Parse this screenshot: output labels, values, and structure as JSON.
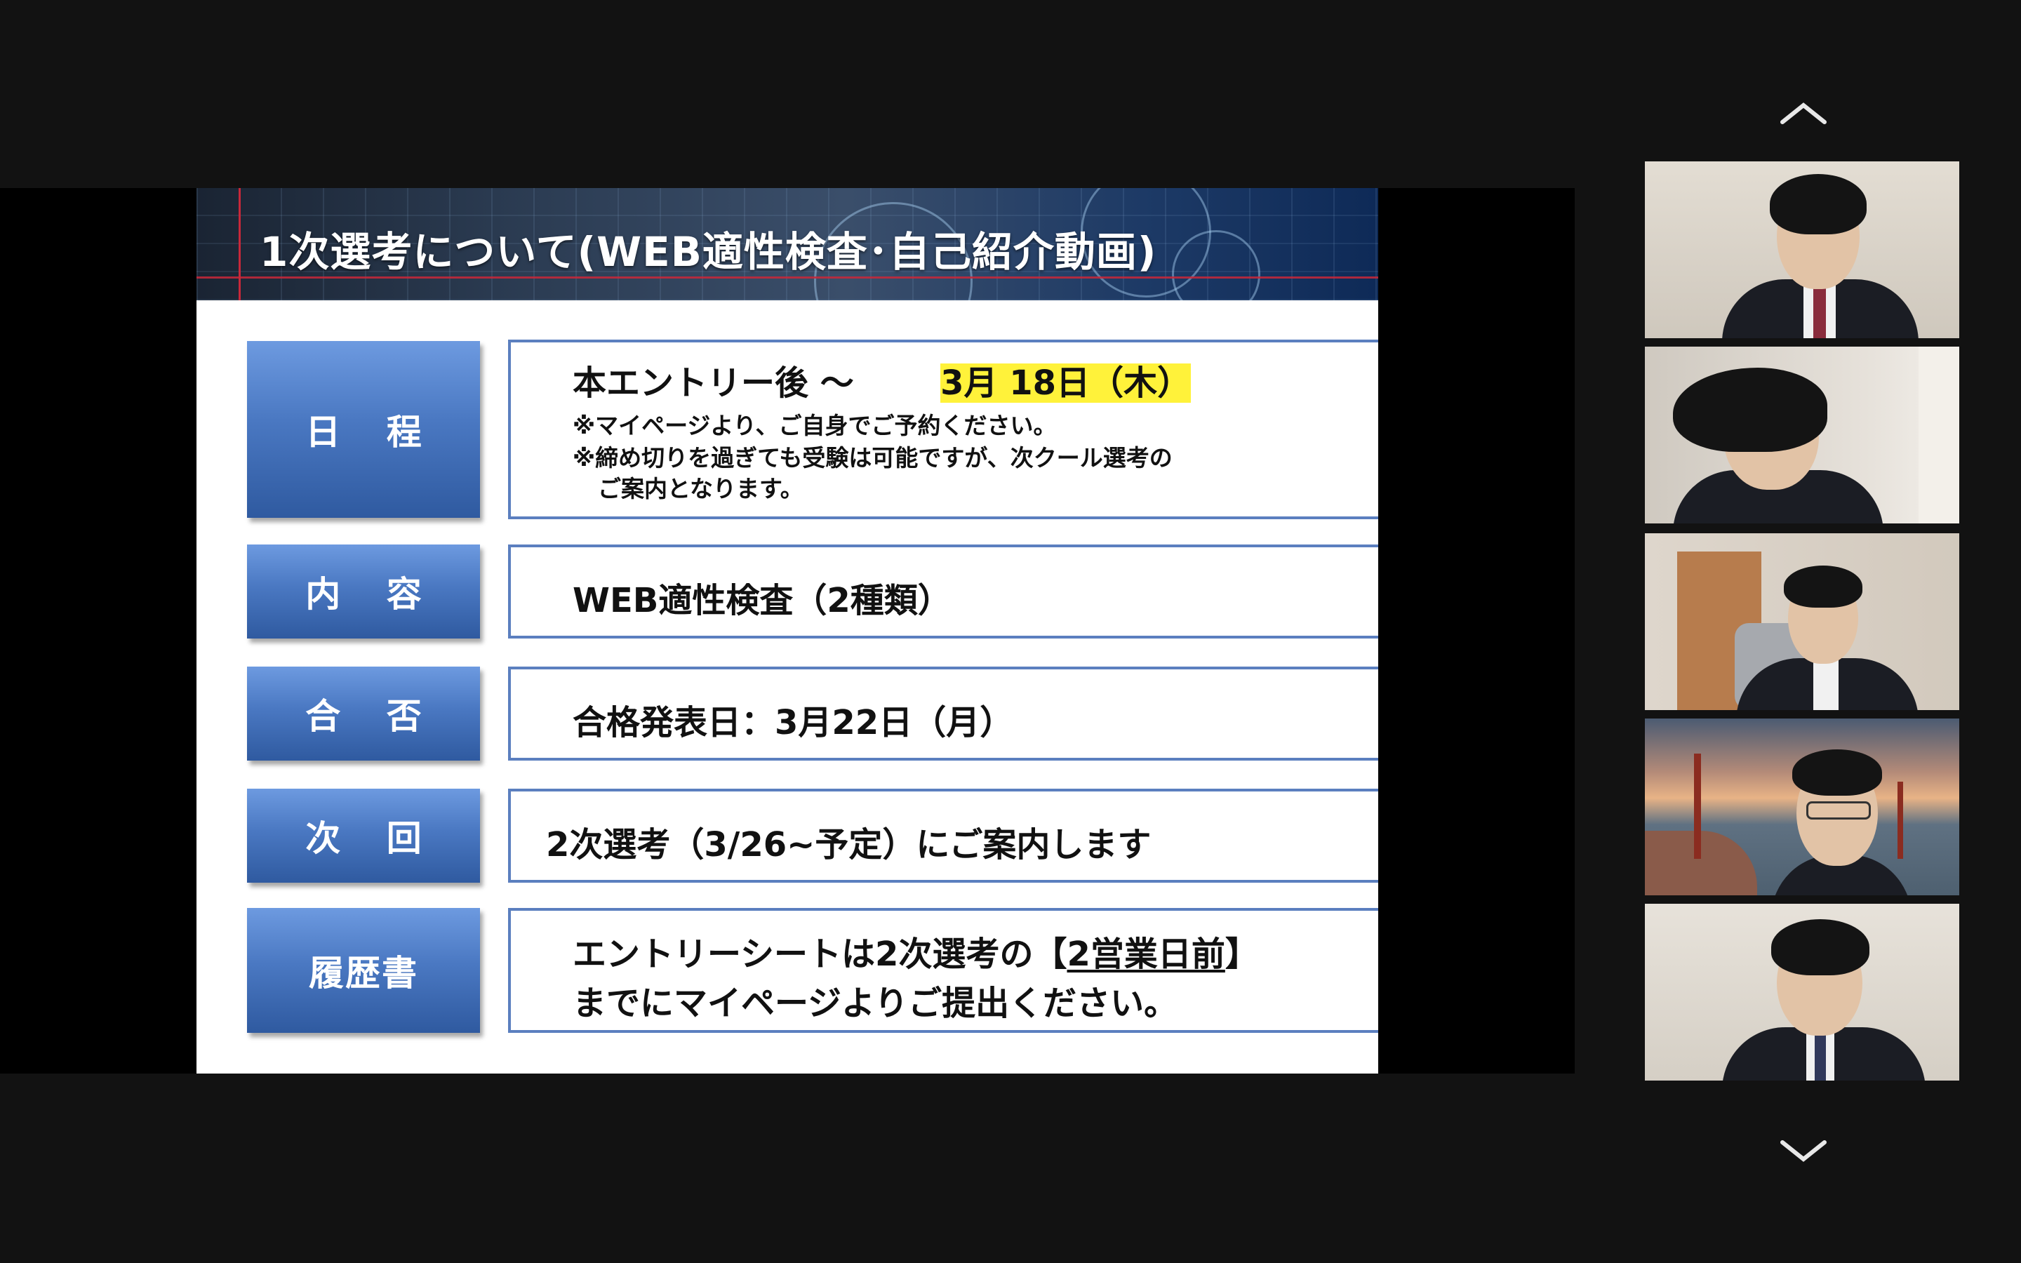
{
  "slide": {
    "title": "1次選考について(WEB適性検査･自己紹介動画)",
    "rows": [
      {
        "label": "日 程",
        "main_prefix": "本エントリー後 ～",
        "main_highlight": "3月 18日（木）",
        "notes": [
          "※マイページより、ご自身でご予約ください。",
          "※締め切りを過ぎても受験は可能ですが、次クール選考の",
          "ご案内となります。"
        ]
      },
      {
        "label": "内 容",
        "text": "WEB適性検査（2種類）"
      },
      {
        "label": "合 否",
        "text": "合格発表日：3月22日（月）"
      },
      {
        "label": "次 回",
        "text": "2次選考（3/26~予定）にご案内します"
      },
      {
        "label": "履歴書",
        "line1_prefix": "エントリーシートは2次選考の",
        "line1_bracket_open": "【",
        "line1_underlined": "2営業日前",
        "line1_bracket_close": "】",
        "line2": "までにマイページよりご提出ください。"
      }
    ]
  },
  "participants": {
    "scroll_up_icon": "chevron-up-icon",
    "scroll_down_icon": "chevron-down-icon",
    "tiles": [
      {
        "id": "participant-1",
        "background": "#d8d2c8"
      },
      {
        "id": "participant-2",
        "background": "#d6d2cc"
      },
      {
        "id": "participant-3",
        "background": "#cfc6bb"
      },
      {
        "id": "participant-4",
        "background": "golden-gate-bridge-sunset"
      },
      {
        "id": "participant-5",
        "background": "#dcd6cc"
      }
    ]
  }
}
